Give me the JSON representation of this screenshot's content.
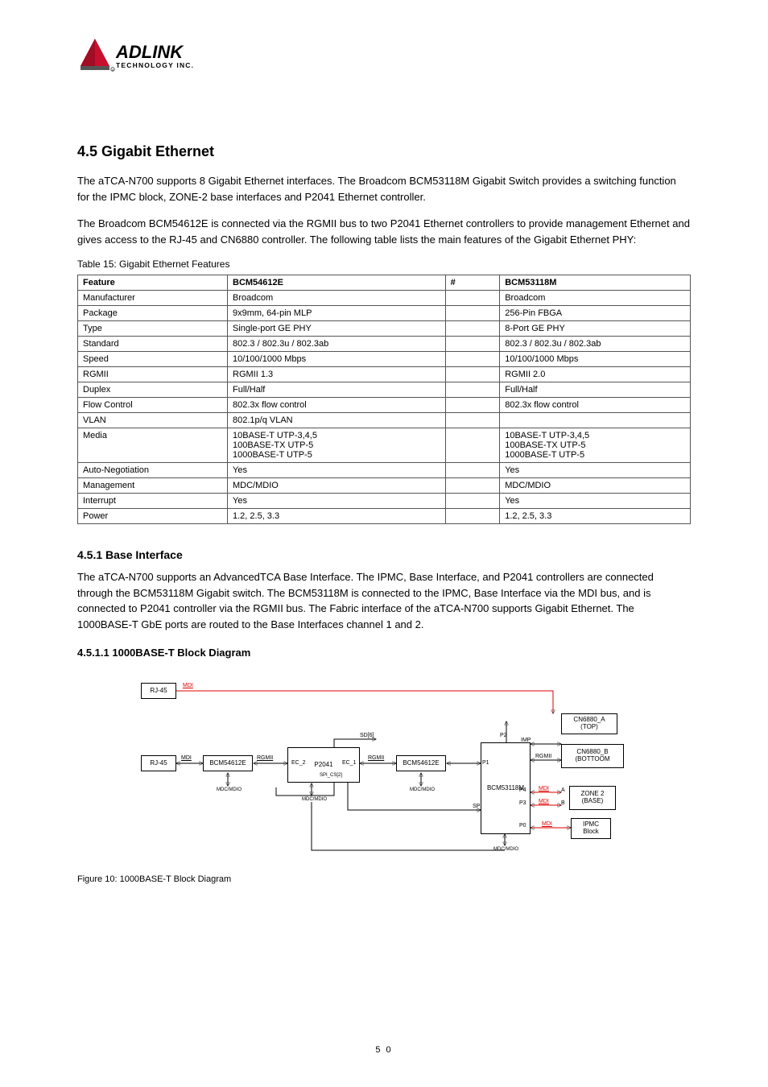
{
  "logo": {
    "brand": "ADLINK",
    "sub": "TECHNOLOGY INC."
  },
  "section": {
    "title": "4.5 Gigabit Ethernet",
    "p1": "The aTCA-N700 supports 8 Gigabit Ethernet interfaces. The Broadcom BCM53118M Gigabit Switch provides a switching function for the IPMC block, ZONE-2 base interfaces and P2041 Ethernet controller.",
    "p2": "The Broadcom BCM54612E is connected via the RGMII bus to two P2041 Ethernet controllers to provide management Ethernet and gives access to the RJ-45 and CN6880 controller. The following table lists the main features of the Gigabit Ethernet PHY:",
    "table_title": "Table 15: Gigabit Ethernet Features",
    "table": {
      "headers": [
        "Feature",
        "BCM54612E",
        "#",
        "BCM53118M"
      ],
      "rows": [
        [
          "Manufacturer",
          "Broadcom",
          "",
          "Broadcom"
        ],
        [
          "Package",
          "9x9mm, 64-pin MLP",
          "",
          "256-Pin FBGA"
        ],
        [
          "Type",
          "Single-port GE PHY",
          "",
          "8-Port GE PHY"
        ],
        [
          "Standard",
          "802.3 / 802.3u / 802.3ab",
          "",
          "802.3 / 802.3u / 802.3ab"
        ],
        [
          "Speed",
          "10/100/1000 Mbps",
          "",
          "10/100/1000 Mbps"
        ],
        [
          "RGMII",
          "RGMII 1.3",
          "",
          "RGMII 2.0"
        ],
        [
          "Duplex",
          "Full/Half",
          "",
          "Full/Half"
        ],
        [
          "Flow Control",
          "802.3x flow control",
          "",
          "802.3x flow control"
        ],
        [
          "VLAN",
          "802.1p/q VLAN",
          "",
          ""
        ],
        [
          "Media",
          "10BASE-T UTP-3,4,5\n100BASE-TX UTP-5\n1000BASE-T UTP-5",
          "",
          "10BASE-T UTP-3,4,5\n100BASE-TX UTP-5\n1000BASE-T UTP-5"
        ],
        [
          "Auto-Negotiation",
          "Yes",
          "",
          "Yes"
        ],
        [
          "Management",
          "MDC/MDIO",
          "",
          "MDC/MDIO"
        ],
        [
          "Interrupt",
          "Yes",
          "",
          "Yes"
        ],
        [
          "Power",
          "1.2, 2.5, 3.3",
          "",
          "1.2, 2.5, 3.3"
        ]
      ]
    },
    "subhead": "4.5.1 Base Interface",
    "subhead_para": "The aTCA-N700 supports an AdvancedTCA Base Interface. The IPMC, Base Interface, and P2041 controllers are connected through the BCM53118M Gigabit switch. The BCM53118M is connected to the IPMC, Base Interface via the MDI bus, and is connected to P2041 controller via the RGMII bus. The Fabric interface of the aTCA-N700 supports Gigabit Ethernet. The 1000BASE-T GbE ports are routed to the Base Interfaces channel 1 and 2.",
    "subsub": "4.5.1.1 1000BASE-T Block Diagram",
    "fig_cap": "Figure 10: 1000BASE-T Block Diagram"
  },
  "diagram": {
    "boxes": {
      "rj45a": "RJ-45",
      "rj45b": "RJ-45",
      "phy1": "BCM54612E",
      "phy2": "BCM54612E",
      "cpu": "P2041",
      "sw": "BCM53118M",
      "cn_a": "CN6880_A\n(TOP)",
      "cn_b": "CN6880_B\n(BOTTOOM",
      "zone2": "ZONE 2\n(BASE)",
      "ipmc": "IPMC\nBlock"
    },
    "labels": {
      "mdi": "MDI",
      "rgmii": "RGMII",
      "mdc": "MDC/MDIO",
      "sd": "SD[6]",
      "spi": "SPI",
      "splcs": "SPI_CS[2]",
      "ec1": "EC_1",
      "ec2": "EC_2",
      "imp": "IMP",
      "p0": "P0",
      "p1": "P1",
      "p2": "P2",
      "p3": "P3",
      "p4": "P4",
      "a": "A",
      "b": "B"
    }
  },
  "page_number": "5 0"
}
